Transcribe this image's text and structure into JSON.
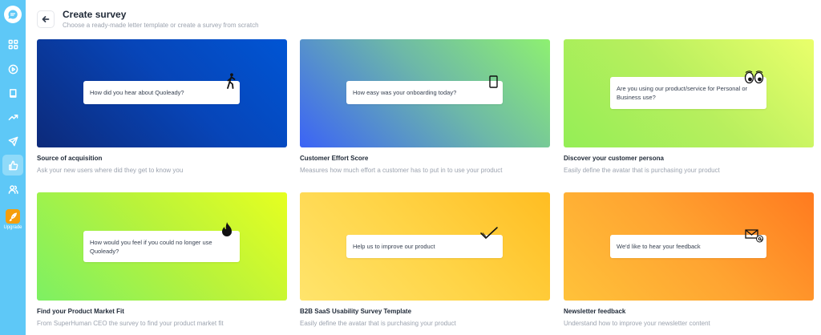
{
  "sidebar": {
    "logo_icon": "chat-bubble-icon",
    "items": [
      {
        "icon": "grid-icon",
        "name": "dashboard"
      },
      {
        "icon": "play-circle-icon",
        "name": "media"
      },
      {
        "icon": "book-icon",
        "name": "library"
      },
      {
        "icon": "trend-up-icon",
        "name": "analytics"
      },
      {
        "icon": "send-icon",
        "name": "campaigns"
      },
      {
        "icon": "thumbs-up-icon",
        "name": "surveys",
        "active": true
      },
      {
        "icon": "users-icon",
        "name": "contacts"
      }
    ],
    "upgrade_label": "Upgrade",
    "accent": "#5ec8f7"
  },
  "header": {
    "title": "Create survey",
    "subtitle": "Choose a ready-made letter template or create a survey from scratch"
  },
  "cards": [
    {
      "title": "Source of acquisition",
      "description": "Ask your new users where did they get to know you",
      "question": "How did you hear about Quoleady?",
      "icon": "person-walking-icon"
    },
    {
      "title": "Customer Effort Score",
      "description": "Measures how much effort a customer has to put in to use your product",
      "question": "How easy was your onboarding today?",
      "icon": "phone-icon"
    },
    {
      "title": "Discover your customer persona",
      "description": "Easily define the avatar that is purchasing your product",
      "question": "Are you using our product/service for Personal or Business use?",
      "icon": "eyes-icon"
    },
    {
      "title": "Find your Product Market Fit",
      "description": "From SuperHuman CEO the survey to find your product market fit",
      "question": "How would you feel if you could no longer use Quoleady?",
      "icon": "flame-icon"
    },
    {
      "title": "B2B SaaS Usability Survey Template",
      "description": "Easily define the avatar that is purchasing your product",
      "question": "Help us to improve our product",
      "icon": "checkmark-icon"
    },
    {
      "title": "Newsletter feedback",
      "description": "Understand how to improve your newsletter content",
      "question": "We'd like to hear your feedback",
      "icon": "mail-at-icon"
    }
  ]
}
